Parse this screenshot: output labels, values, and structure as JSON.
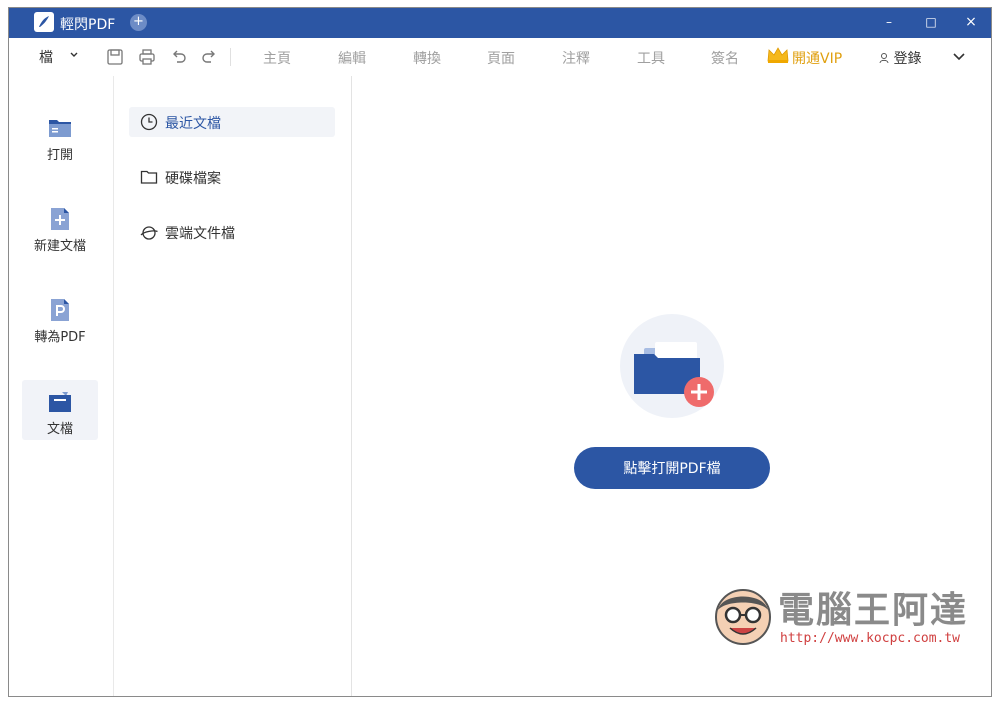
{
  "window": {
    "title": "輕閃PDF",
    "add_tab": "+",
    "minimize": "–",
    "maximize": "□",
    "close": "×"
  },
  "toolbar": {
    "file_menu": "檔",
    "menu": [
      "主頁",
      "編輯",
      "轉換",
      "頁面",
      "注釋",
      "工具",
      "簽名"
    ],
    "vip_label": "開通VIP",
    "login_label": "登錄"
  },
  "leftnav": [
    {
      "label": "打開",
      "icon": "open-folder-icon"
    },
    {
      "label": "新建文檔",
      "icon": "new-document-icon"
    },
    {
      "label": "轉為PDF",
      "icon": "convert-pdf-icon"
    },
    {
      "label": "文檔",
      "icon": "documents-icon",
      "active": true
    }
  ],
  "subnav": [
    {
      "label": "最近文檔",
      "icon": "clock-icon",
      "active": true
    },
    {
      "label": "硬碟檔案",
      "icon": "folder-icon"
    },
    {
      "label": "雲端文件檔",
      "icon": "cloud-icon"
    }
  ],
  "main": {
    "open_button_label": "點擊打開PDF檔"
  },
  "watermark": {
    "title": "電腦王阿達",
    "url": "http://www.kocpc.com.tw"
  },
  "colors": {
    "brand": "#2c56a4",
    "vip": "#e0a010",
    "plus_badge": "#ef6b6b",
    "muted_text": "#a0a0a0"
  }
}
